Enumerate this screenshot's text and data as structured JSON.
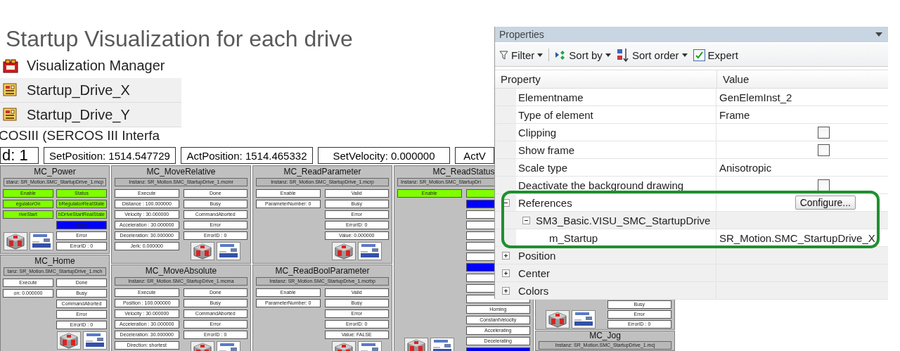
{
  "title": "Startup Visualization for each drive",
  "tree": [
    {
      "label": "Visualization Manager",
      "kind": "manager",
      "selected": false
    },
    {
      "label": "Startup_Drive_X",
      "kind": "visualization",
      "selected": true
    },
    {
      "label": "Startup_Drive_Y",
      "kind": "visualization",
      "selected": true
    }
  ],
  "cut_line": "COSIII (SERCOS III Interfa",
  "visualization": {
    "status_fields": [
      "d: 1",
      "SetPosition: 1514.547729",
      "ActPosition: 1514.465332",
      "SetVelocity: 0.000000",
      "ActV"
    ],
    "columns": [
      {
        "blocks": [
          {
            "title": "MC_Power",
            "instance": "stanz: SR_Motion.SMC_StartupDrive_1.mcp",
            "inputs": [
              {
                "kind": "field",
                "text": "Enable",
                "color": "#80ff00"
              },
              {
                "kind": "field",
                "text": "egulatorOn",
                "color": "#80ff00"
              },
              {
                "kind": "field",
                "text": "riveStart",
                "color": "#80ff00"
              },
              {
                "kind": "logos"
              }
            ],
            "outputs": [
              {
                "kind": "field",
                "text": "Status",
                "color": "#80ff00"
              },
              {
                "kind": "field",
                "text": "bRegulatorRealState",
                "color": "#80ff00"
              },
              {
                "kind": "field",
                "text": "bDriveStartRealState",
                "color": "#80ff00"
              },
              {
                "kind": "field",
                "text": "Busy",
                "color": "#0000ff"
              },
              {
                "kind": "field",
                "text": "Error",
                "color": "#ffffff"
              },
              {
                "kind": "field",
                "text": "ErrorID : 0",
                "color": "#ffffff"
              }
            ]
          },
          {
            "title": "MC_Home",
            "instance": "tanz: SR_Motion.SMC_StartupDrive_1.mch",
            "inputs": [
              {
                "kind": "field",
                "text": "Execute",
                "color": "#ffffff"
              },
              {
                "kind": "field",
                "text": "on: 0.000000",
                "color": "#ffffff"
              }
            ],
            "outputs": [
              {
                "kind": "field",
                "text": "Done",
                "color": "#ffffff"
              },
              {
                "kind": "field",
                "text": "Busy",
                "color": "#ffffff"
              },
              {
                "kind": "field",
                "text": "CommandAborted",
                "color": "#ffffff"
              },
              {
                "kind": "field",
                "text": "Error",
                "color": "#ffffff"
              },
              {
                "kind": "field",
                "text": "ErrorID : 0",
                "color": "#ffffff"
              },
              {
                "kind": "logos"
              }
            ]
          }
        ]
      },
      {
        "blocks": [
          {
            "title": "MC_MoveRelative",
            "instance": "Instanz: SR_Motion.SMC_StartupDrive_1.mcmr",
            "inputs": [
              {
                "kind": "field",
                "text": "Execute",
                "color": "#ffffff"
              },
              {
                "kind": "field",
                "text": "Distance : 100.000000",
                "color": "#ffffff"
              },
              {
                "kind": "field",
                "text": "Velocity : 30.000000",
                "color": "#ffffff"
              },
              {
                "kind": "field",
                "text": "Acceleration : 30.000000",
                "color": "#ffffff"
              },
              {
                "kind": "field",
                "text": "Deceleration: 30.000000",
                "color": "#ffffff"
              },
              {
                "kind": "field",
                "text": "Jerk: 0.000000",
                "color": "#ffffff"
              }
            ],
            "outputs": [
              {
                "kind": "field",
                "text": "Done",
                "color": "#ffffff"
              },
              {
                "kind": "field",
                "text": "Busy",
                "color": "#ffffff"
              },
              {
                "kind": "field",
                "text": "CommandAborted",
                "color": "#ffffff"
              },
              {
                "kind": "field",
                "text": "Error",
                "color": "#ffffff"
              },
              {
                "kind": "field",
                "text": "ErrorID : 0",
                "color": "#ffffff"
              },
              {
                "kind": "logos"
              }
            ]
          },
          {
            "title": "MC_MoveAbsolute",
            "instance": "Instanz: SR_Motion.SMC_StartupDrive_1.mcma",
            "inputs": [
              {
                "kind": "field",
                "text": "Execute",
                "color": "#ffffff"
              },
              {
                "kind": "field",
                "text": "Position : 100.000000",
                "color": "#ffffff"
              },
              {
                "kind": "field",
                "text": "Velocity : 30.000000",
                "color": "#ffffff"
              },
              {
                "kind": "field",
                "text": "Acceleration : 30.000000",
                "color": "#ffffff"
              },
              {
                "kind": "field",
                "text": "Deceleration: 30.000000",
                "color": "#ffffff"
              },
              {
                "kind": "field",
                "text": "Direction: shortest",
                "color": "#ffffff"
              }
            ],
            "outputs": [
              {
                "kind": "field",
                "text": "Done",
                "color": "#ffffff"
              },
              {
                "kind": "field",
                "text": "Busy",
                "color": "#ffffff"
              },
              {
                "kind": "field",
                "text": "CommandAborted",
                "color": "#ffffff"
              },
              {
                "kind": "field",
                "text": "Error",
                "color": "#ffffff"
              },
              {
                "kind": "field",
                "text": "ErrorID : 0",
                "color": "#ffffff"
              },
              {
                "kind": "logos"
              }
            ]
          }
        ]
      },
      {
        "blocks": [
          {
            "title": "MC_ReadParameter",
            "instance": "Instanz: SR_Motion.SMC_StartupDrive_1.mcrp",
            "inputs": [
              {
                "kind": "field",
                "text": "Enable",
                "color": "#ffffff"
              },
              {
                "kind": "field",
                "text": "ParameterNumber: 0",
                "color": "#ffffff"
              }
            ],
            "outputs": [
              {
                "kind": "field",
                "text": "Valid",
                "color": "#ffffff"
              },
              {
                "kind": "field",
                "text": "Busy",
                "color": "#ffffff"
              },
              {
                "kind": "field",
                "text": "Error",
                "color": "#ffffff"
              },
              {
                "kind": "field",
                "text": "ErrorID: 0",
                "color": "#ffffff"
              },
              {
                "kind": "field",
                "text": "Value: 0.000000",
                "color": "#ffffff"
              },
              {
                "kind": "logos"
              }
            ]
          },
          {
            "title": "MC_ReadBoolParameter",
            "instance": "Instanz: SR_Motion.SMC_StartupDrive_1.mcrbp",
            "inputs": [
              {
                "kind": "field",
                "text": "Enable",
                "color": "#ffffff"
              },
              {
                "kind": "field",
                "text": "ParameterNumber: 0",
                "color": "#ffffff"
              }
            ],
            "outputs": [
              {
                "kind": "field",
                "text": "Valid",
                "color": "#ffffff"
              },
              {
                "kind": "field",
                "text": "Busy",
                "color": "#ffffff"
              },
              {
                "kind": "field",
                "text": "Error",
                "color": "#ffffff"
              },
              {
                "kind": "field",
                "text": "ErrorID: 0",
                "color": "#ffffff"
              },
              {
                "kind": "field",
                "text": "Value: FALSE",
                "color": "#ffffff"
              },
              {
                "kind": "logos"
              }
            ]
          }
        ]
      },
      {
        "blocks": [
          {
            "title": "MC_ReadStatus",
            "instance": "Instanz: SR_Motion.SMC_StartupDri",
            "inputs": [
              {
                "kind": "field",
                "text": "Enable",
                "color": "#80ff00"
              },
              {
                "kind": "logos"
              }
            ],
            "outputs": [
              {
                "kind": "field",
                "color": "#80ff00"
              },
              {
                "kind": "field",
                "color": "#0000ff"
              },
              {
                "kind": "field",
                "color": "#ffffff"
              },
              {
                "kind": "field",
                "color": "#ffffff"
              },
              {
                "kind": "field",
                "color": "#ffffff"
              },
              {
                "kind": "field",
                "color": "#ffffff"
              },
              {
                "kind": "field",
                "color": "#ffffff"
              },
              {
                "kind": "field",
                "color": "#0000ff"
              },
              {
                "kind": "field",
                "color": "#ffffff"
              },
              {
                "kind": "field",
                "color": "#ffffff"
              },
              {
                "kind": "field",
                "color": "#ffffff"
              },
              {
                "kind": "field",
                "text": "Homing",
                "color": "#ffffff"
              },
              {
                "kind": "field",
                "text": "ConstantVelocity",
                "color": "#ffffff"
              },
              {
                "kind": "field",
                "text": "Accelerating",
                "color": "#ffffff"
              },
              {
                "kind": "field",
                "text": "Decelerating",
                "color": "#ffffff"
              },
              {
                "kind": "field",
                "color": "#0000ff"
              }
            ]
          }
        ]
      },
      {
        "blocks": [
          {
            "inputs": [
              {
                "kind": "logos"
              }
            ],
            "outputs": [
              {
                "kind": "field",
                "text": "Busy",
                "color": "#ffffff"
              },
              {
                "kind": "field",
                "text": "Error",
                "color": "#ffffff"
              },
              {
                "kind": "field",
                "text": "ErrorID : 0",
                "color": "#ffffff"
              }
            ]
          },
          {
            "title": "MC_Jog",
            "instance": "Instanz: SR_Motion.SMC_StartupDrive_1.mcj"
          }
        ]
      }
    ]
  },
  "properties": {
    "title": "Properties",
    "toolbar": [
      {
        "label": "Filter",
        "kind": "filter"
      },
      {
        "label": "Sort by",
        "kind": "sortby"
      },
      {
        "label": "Sort order",
        "kind": "sortorder"
      },
      {
        "label": "Expert",
        "kind": "checkbox",
        "checked": true
      }
    ],
    "columns": [
      "Property",
      "Value"
    ],
    "rows": [
      {
        "property": "Elementname",
        "kind": "text",
        "value": "GenElemInst_2"
      },
      {
        "property": "Type of element",
        "kind": "text",
        "value": "Frame"
      },
      {
        "property": "Clipping",
        "kind": "checkbox",
        "checked": false
      },
      {
        "property": "Show frame",
        "kind": "checkbox",
        "checked": false
      },
      {
        "property": "Scale type",
        "kind": "text",
        "value": "Anisotropic"
      },
      {
        "property": "Deactivate the background drawing",
        "kind": "checkbox",
        "checked": false
      },
      {
        "property": "References",
        "kind": "button",
        "value": "Configure...",
        "expanded": true,
        "children": [
          {
            "property": "SM3_Basic.VISU_SMC_StartupDrive",
            "kind": "group",
            "expanded": true,
            "children": [
              {
                "property": "m_Startup",
                "kind": "text",
                "value": "SR_Motion.SMC_StartupDrive_X"
              }
            ]
          }
        ]
      },
      {
        "property": "Position",
        "kind": "group",
        "expanded": false
      },
      {
        "property": "Center",
        "kind": "group",
        "expanded": false
      },
      {
        "property": "Colors",
        "kind": "group",
        "expanded": false
      }
    ]
  }
}
